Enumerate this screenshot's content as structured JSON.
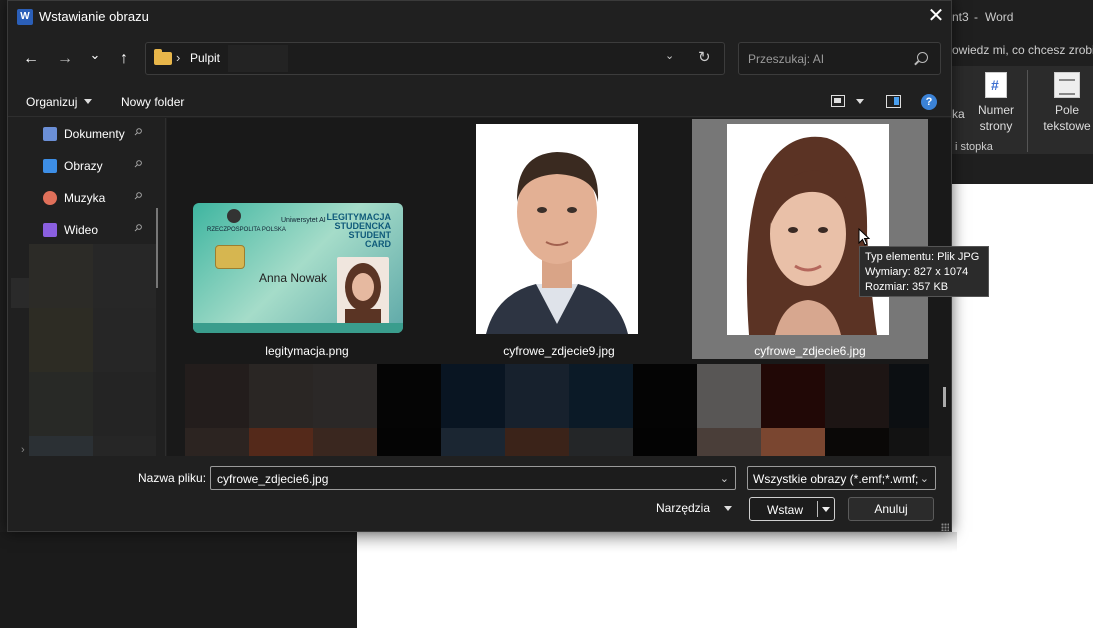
{
  "word": {
    "title_fragment": "nt3",
    "title_sep": "-",
    "app_name": "Word",
    "tell_me": "owiedz mi, co chcesz zrobi",
    "ribbon": {
      "item_partial": "ka",
      "page_number_label": "Numer strony",
      "text_box_label": "Pole tekstowe",
      "group_label": "i stopka"
    }
  },
  "dialog": {
    "title": "Wstawianie obrazu",
    "app_icon": "W",
    "close_glyph": "✕",
    "nav": {
      "back_glyph": "←",
      "forward_glyph": "→",
      "recent_glyph": "⌄",
      "up_glyph": "↑"
    },
    "address": {
      "separator": "›",
      "location": "Pulpit",
      "drop_glyph": "⌄",
      "refresh_glyph": "↻"
    },
    "search_placeholder": "Przeszukaj: AI",
    "toolbar": {
      "organize_label": "Organizuj",
      "new_folder_label": "Nowy folder",
      "help_glyph": "?"
    },
    "sidebar": {
      "items": [
        {
          "label": "Dokumenty",
          "icon": "documents-icon",
          "color": "#6b8fd6"
        },
        {
          "label": "Obrazy",
          "icon": "pictures-icon",
          "color": "#3d8ee6"
        },
        {
          "label": "Muzyka",
          "icon": "music-icon",
          "color": "#e0705a"
        },
        {
          "label": "Wideo",
          "icon": "video-icon",
          "color": "#8a5fe0"
        }
      ],
      "pin_glyph": "📌"
    },
    "files": [
      {
        "name": "legitymacja.png",
        "selected": false
      },
      {
        "name": "cyfrowe_zdjecie9.jpg",
        "selected": false
      },
      {
        "name": "cyfrowe_zdjecie6.jpg",
        "selected": true
      }
    ],
    "id_card": {
      "university": "Uniwersytet AI",
      "card_title": "LEGITYMACJA STUDENCKA STUDENT CARD",
      "country": "RZECZPOSPOLITA POLSKA",
      "holder_name": "Anna Nowak"
    },
    "tooltip": {
      "type": "Typ elementu: Plik JPG",
      "dimensions": "Wymiary: 827 x 1074",
      "size": "Rozmiar: 357 KB"
    },
    "filename_label": "Nazwa pliku:",
    "filename_value": "cyfrowe_zdjecie6.jpg",
    "filetype_value": "Wszystkie obrazy (*.emf;*.wmf;",
    "tools_label": "Narzędzia",
    "insert_label": "Wstaw",
    "cancel_label": "Anuluj",
    "dropdown_glyph": "⌄"
  }
}
